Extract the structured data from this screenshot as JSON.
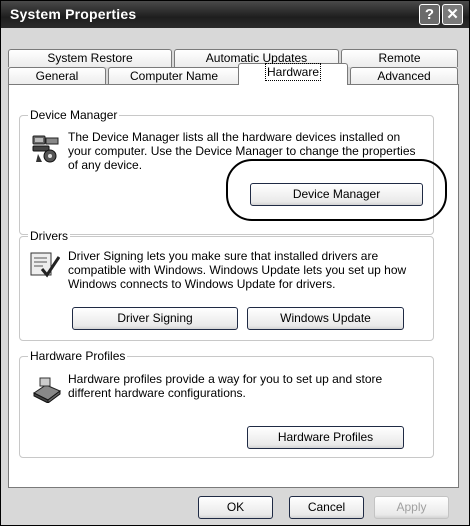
{
  "window": {
    "title": "System Properties",
    "help_label": "?",
    "close_label": "✕"
  },
  "tabs": {
    "top_row": [
      "System Restore",
      "Automatic Updates",
      "Remote"
    ],
    "bottom_row": [
      "General",
      "Computer Name",
      "Hardware",
      "Advanced"
    ],
    "active": "Hardware"
  },
  "device_manager": {
    "title": "Device Manager",
    "description": "The Device Manager lists all the hardware devices installed on your computer. Use the Device Manager to change the properties of any device.",
    "button": "Device Manager",
    "icon": "device-manager-icon"
  },
  "drivers": {
    "title": "Drivers",
    "description": "Driver Signing lets you make sure that installed drivers are compatible with Windows. Windows Update lets you set up how Windows connects to Windows Update for drivers.",
    "signing_button": "Driver Signing",
    "update_button": "Windows Update",
    "icon": "driver-signing-icon"
  },
  "hardware_profiles": {
    "title": "Hardware Profiles",
    "description": "Hardware profiles provide a way for you to set up and store different hardware configurations.",
    "button": "Hardware Profiles",
    "icon": "hardware-profiles-icon"
  },
  "footer": {
    "ok": "OK",
    "cancel": "Cancel",
    "apply": "Apply"
  }
}
